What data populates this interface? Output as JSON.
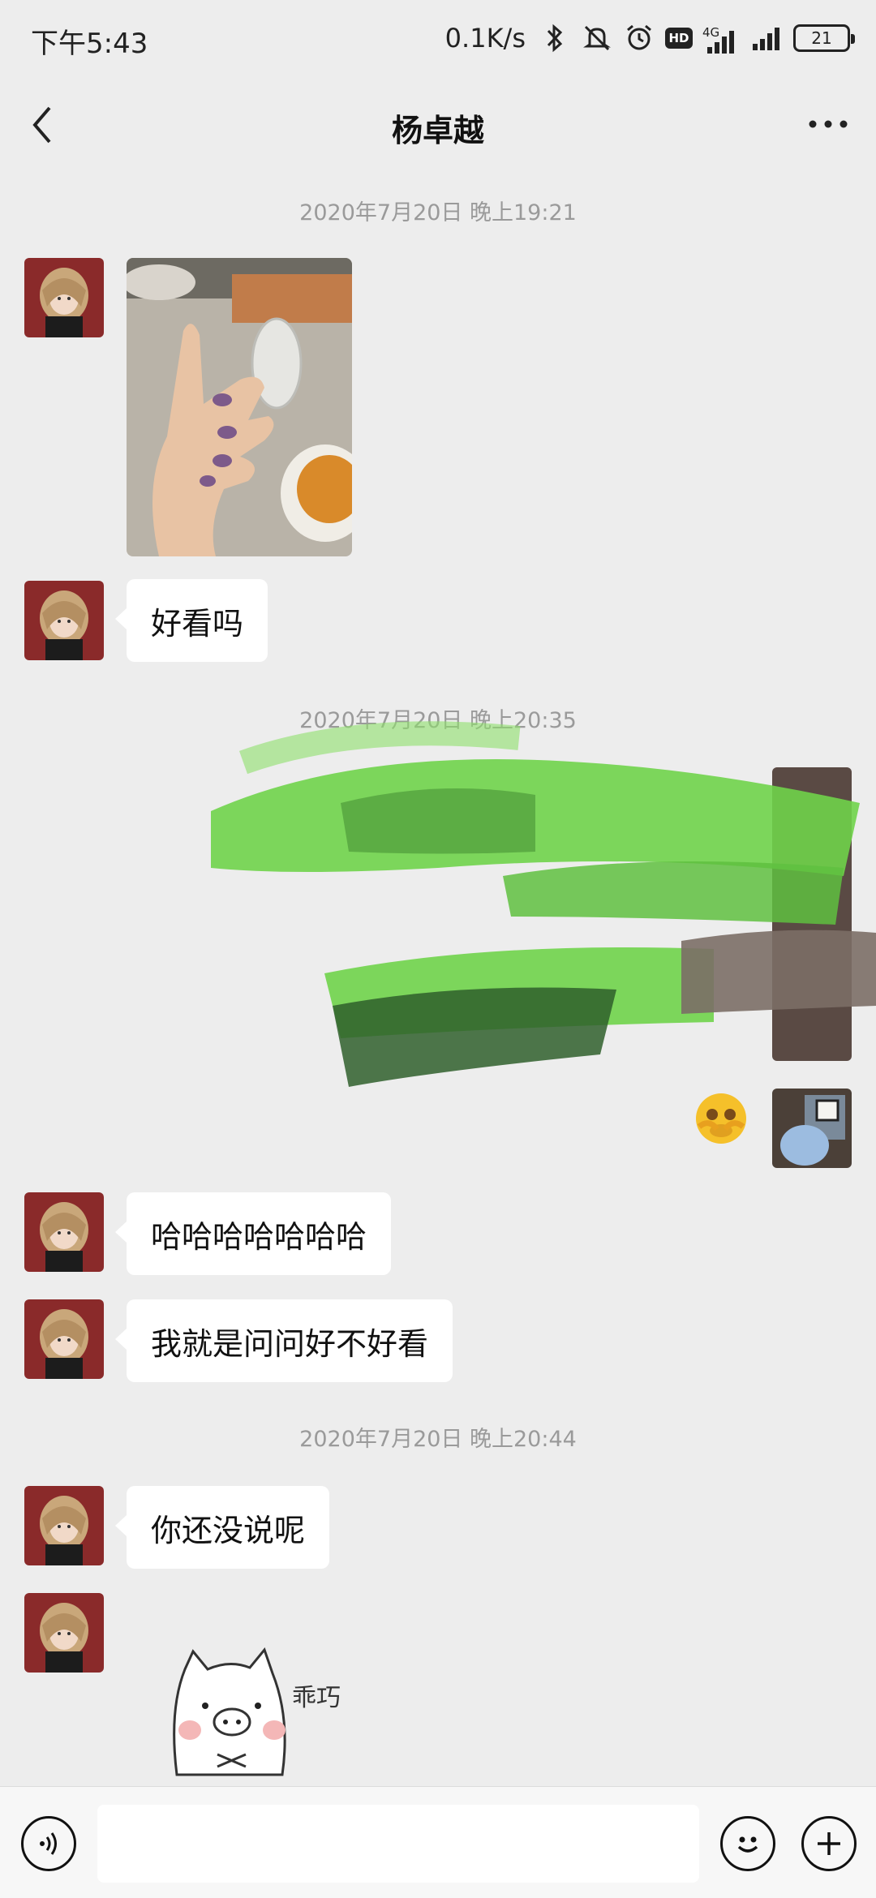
{
  "status_bar": {
    "time": "下午5:43",
    "net_speed": "0.1K/s",
    "hd_label": "HD",
    "network_type": "4G",
    "battery": "21",
    "icons": [
      "bluetooth-icon",
      "mute-bell-icon",
      "alarm-icon",
      "hd-icon",
      "signal-icon",
      "signal-icon",
      "battery-icon"
    ]
  },
  "header": {
    "title": "杨卓越",
    "back_icon": "chevron-left-icon",
    "more_icon": "more-dots-icon"
  },
  "messages": {
    "ts1": "2020年7月20日 晚上19:21",
    "msg1_text": "好看吗",
    "ts2": "2020年7月20日 晚上20:35",
    "msg2_text": "哈哈哈哈哈哈哈",
    "msg3_text": "我就是问问好不好看",
    "ts3": "2020年7月20日 晚上20:44",
    "msg4_text": "你还没说呢",
    "sticker_text": "乖巧"
  },
  "input_bar": {
    "placeholder": "",
    "voice_icon": "voice-icon",
    "emoji_icon": "emoji-icon",
    "add_icon": "plus-icon"
  },
  "colors": {
    "background": "#ededed",
    "bubble_received": "#ffffff",
    "scribble_green": "#6fd34a",
    "avatar_red": "#8a2a2a"
  }
}
